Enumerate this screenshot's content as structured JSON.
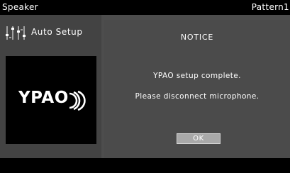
{
  "header": {
    "title": "Speaker",
    "pattern": "Pattern1"
  },
  "sidebar": {
    "menu_item": {
      "label": "Auto Setup",
      "icon": "equalizer-icon"
    },
    "logo": {
      "text": "YPAO",
      "icon": "sound-waves-icon"
    }
  },
  "dialog": {
    "title": "NOTICE",
    "message_line1": "YPAO setup complete.",
    "message_line2": "Please disconnect microphone.",
    "ok_label": "OK"
  },
  "colors": {
    "background": "#000000",
    "panel": "#4b4b4b",
    "sidebar": "#434343",
    "button": "#a9a9a9",
    "text": "#ffffff"
  }
}
